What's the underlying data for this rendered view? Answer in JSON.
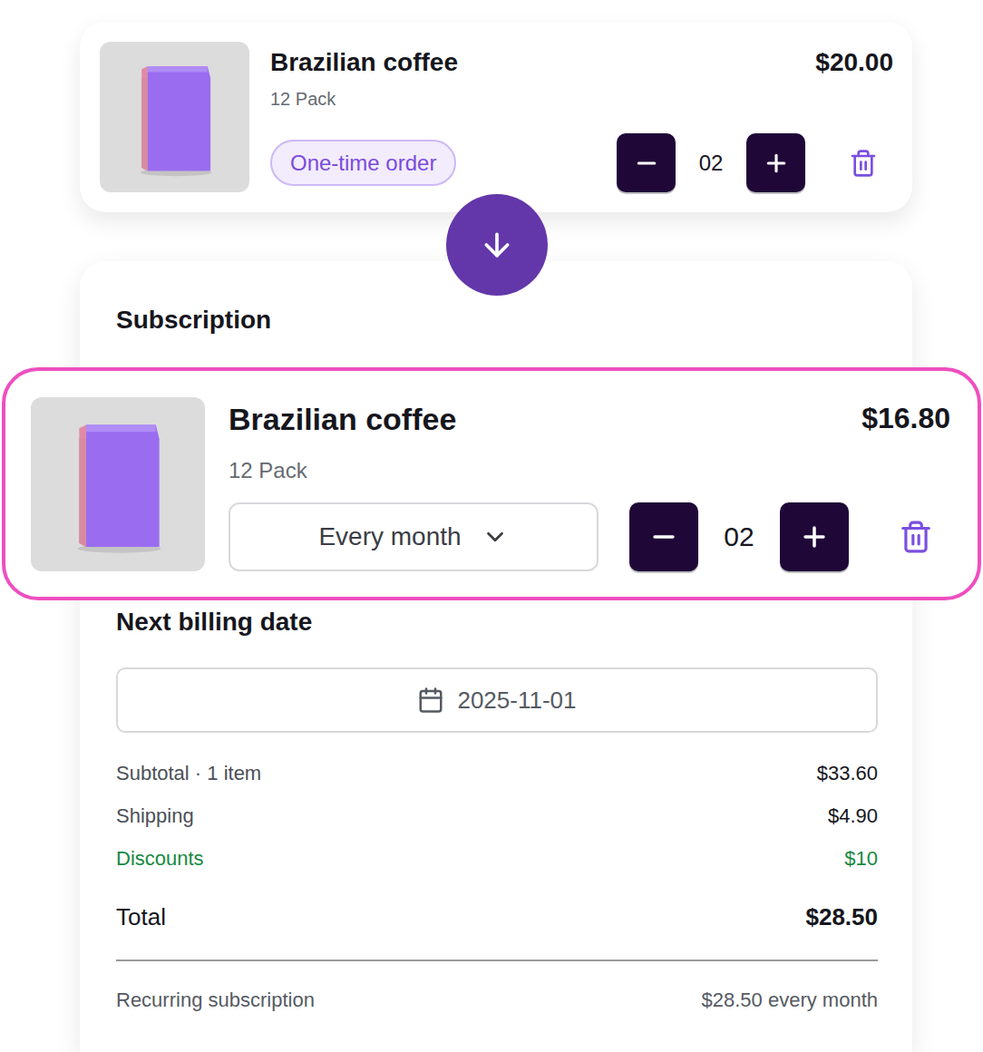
{
  "one_time_item": {
    "name": "Brazilian coffee",
    "variant": "12 Pack",
    "price": "$20.00",
    "badge": "One-time order",
    "quantity": "02"
  },
  "subscription": {
    "heading": "Subscription",
    "item": {
      "name": "Brazilian coffee",
      "variant": "12 Pack",
      "price": "$16.80",
      "frequency": "Every month",
      "quantity": "02",
      "highlighted": true
    }
  },
  "billing": {
    "label": "Next billing date",
    "date": "2025-11-01"
  },
  "summary": [
    {
      "label": "Subtotal · 1 item",
      "value": "$33.60",
      "kind": "normal"
    },
    {
      "label": "Shipping",
      "value": "$4.90",
      "kind": "normal"
    },
    {
      "label": "Discounts",
      "value": "$10",
      "kind": "discount"
    }
  ],
  "total": {
    "label": "Total",
    "value": "$28.50"
  },
  "recurring": {
    "label": "Recurring subscription",
    "value": "$28.50 every month"
  }
}
